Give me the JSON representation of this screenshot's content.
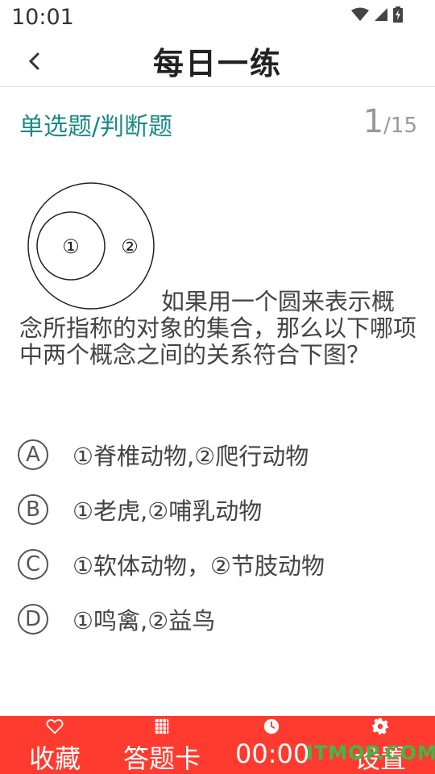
{
  "status_bar": {
    "time": "10:01"
  },
  "header": {
    "title": "每日一练"
  },
  "question_header": {
    "type": "单选题/判断题",
    "current": "1",
    "total": "/15"
  },
  "diagram": {
    "inner_label": "①",
    "outer_label": "②"
  },
  "question": {
    "text": "如果用一个圆来表示概念所指称的对象的集合，那么以下哪项中两个概念之间的关系符合下图？"
  },
  "options": [
    {
      "letter": "A",
      "text": "①脊椎动物,②爬行动物"
    },
    {
      "letter": "B",
      "text": "①老虎,②哺乳动物"
    },
    {
      "letter": "C",
      "text": "①软体动物，②节肢动物"
    },
    {
      "letter": "D",
      "text": "①鸣禽,②益鸟"
    }
  ],
  "bottom_bar": {
    "favorite": "收藏",
    "answer_card": "答题卡",
    "timer": "00:00",
    "settings": "设置"
  },
  "watermark": "ITMOP.COM"
}
